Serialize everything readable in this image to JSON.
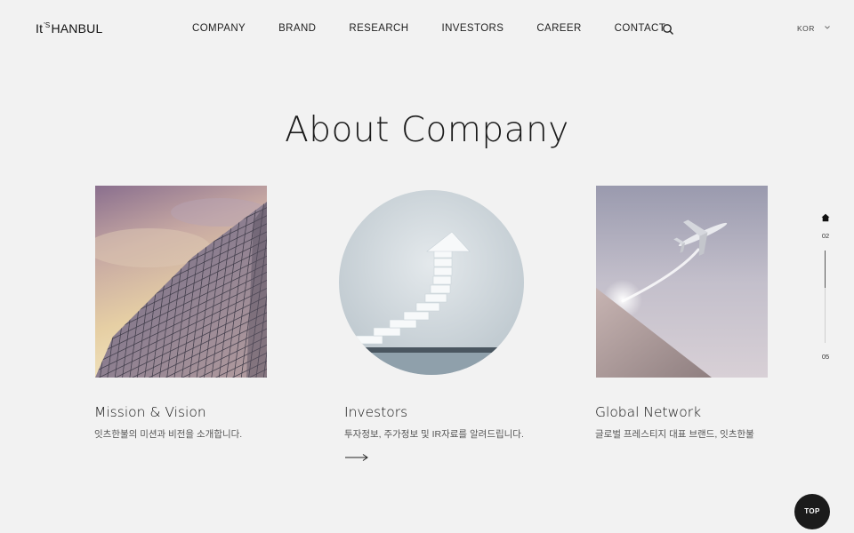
{
  "header": {
    "logo_main": "It",
    "logo_sup": "'S",
    "logo_rest": "HANBUL",
    "nav": [
      "COMPANY",
      "BRAND",
      "RESEARCH",
      "INVESTORS",
      "CAREER",
      "CONTACT"
    ],
    "search_icon": "search-icon",
    "language": "KOR"
  },
  "main": {
    "title": "About Company",
    "cards": [
      {
        "title": "Mission & Vision",
        "desc": "잇츠한불의 미션과 비전을 소개합니다."
      },
      {
        "title": "Investors",
        "desc": "투자정보, 주가정보 및 IR자료를 알려드립니다.",
        "arrow_icon": "arrow-right-icon"
      },
      {
        "title": "Global Network",
        "desc": "글로벌 프레스티지 대표 브랜드, 잇츠한불"
      }
    ]
  },
  "side_nav": {
    "current": "02",
    "total": "05",
    "progress": 0.4
  },
  "top_button": "TOP"
}
